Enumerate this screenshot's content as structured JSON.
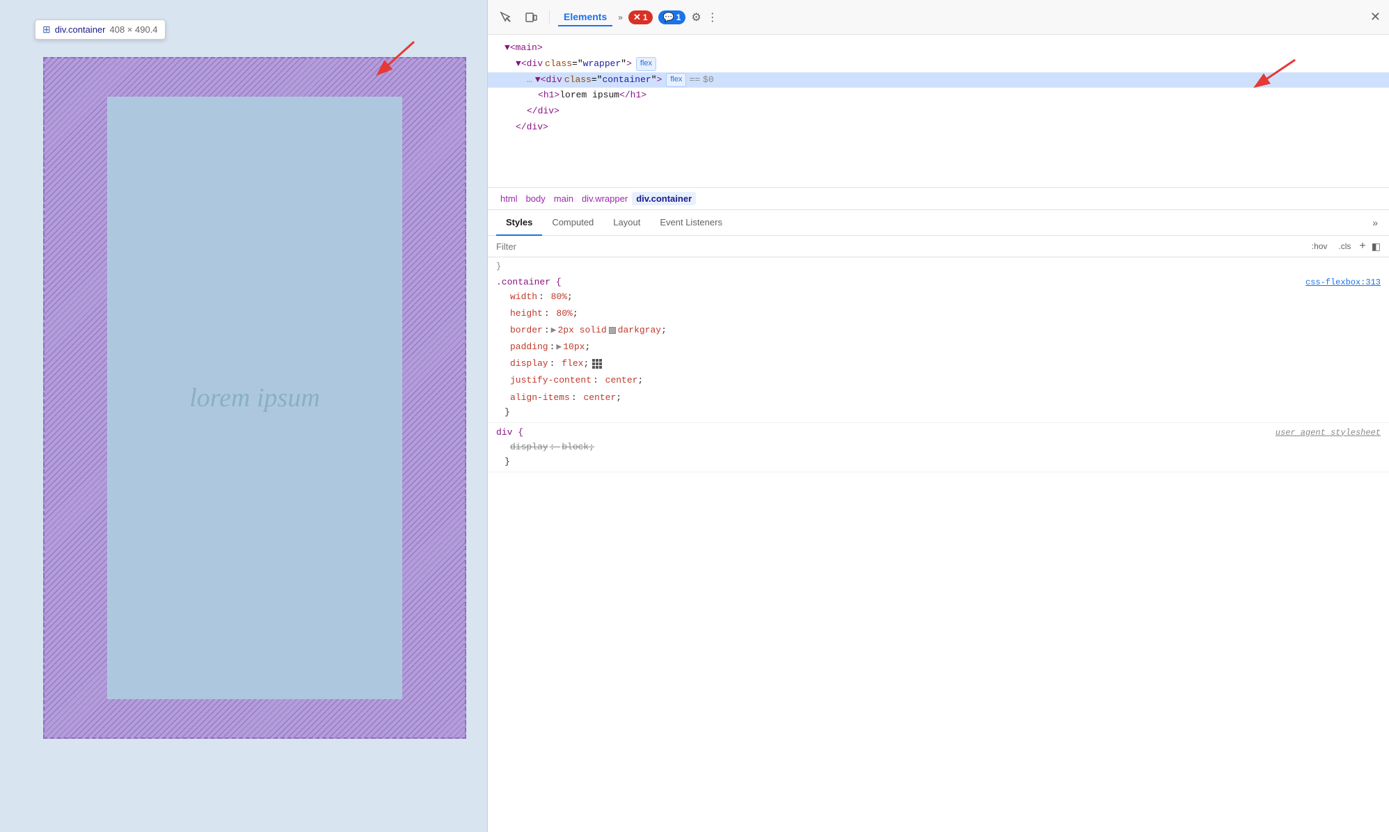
{
  "tooltip": {
    "icon": "⊞",
    "element_name": "div.container",
    "size": "408 × 490.4"
  },
  "preview": {
    "lorem_text": "lorem ipsum"
  },
  "devtools": {
    "toolbar": {
      "inspect_icon": "↖",
      "device_icon": "⧉",
      "tab_elements": "Elements",
      "chevron": "»",
      "error_count": "1",
      "comment_count": "1",
      "gear_icon": "⚙",
      "more_icon": "⋮",
      "close_icon": "✕"
    },
    "html_tree": [
      {
        "indent": 1,
        "content": "▼<main>",
        "type": "tag"
      },
      {
        "indent": 2,
        "content": "▼<div class=\"wrapper\">",
        "type": "tag",
        "badge": "flex"
      },
      {
        "indent": 3,
        "content": "▼<div class=\"container\">",
        "type": "tag",
        "badge": "flex",
        "selected": true,
        "extra": "== $0"
      },
      {
        "indent": 4,
        "content": "<h1>lorem ipsum</h1>",
        "type": "tag"
      },
      {
        "indent": 3,
        "content": "</div>",
        "type": "tag"
      },
      {
        "indent": 2,
        "content": "</div>",
        "type": "tag"
      }
    ],
    "breadcrumbs": [
      "html",
      "body",
      "main",
      "div.wrapper",
      "div.container"
    ],
    "panel_tabs": [
      "Styles",
      "Computed",
      "Layout",
      "Event Listeners",
      "»"
    ],
    "filter_placeholder": "Filter",
    "filter_buttons": [
      ":hov",
      ".cls",
      "+"
    ],
    "css_rules": [
      {
        "selector": ".container {",
        "source": "css-flexbox:313",
        "props": [
          {
            "name": "width",
            "value": "80%",
            "semicolon": true
          },
          {
            "name": "height",
            "value": "80%",
            "semicolon": true
          },
          {
            "name": "border",
            "value": "2px solid",
            "color_swatch": "darkgray",
            "color_name": "darkgray",
            "semicolon": true
          },
          {
            "name": "padding",
            "value": "10px",
            "has_arrow": true,
            "semicolon": true
          },
          {
            "name": "display",
            "value": "flex",
            "has_icon": true,
            "semicolon": true
          },
          {
            "name": "justify-content",
            "value": "center",
            "semicolon": true
          },
          {
            "name": "align-items",
            "value": "center",
            "semicolon": true
          }
        ]
      },
      {
        "selector": "div {",
        "source": "user agent stylesheet",
        "source_italic": true,
        "props": [
          {
            "name": "display",
            "value": "block",
            "semicolon": true,
            "strikethrough": true
          }
        ]
      }
    ]
  }
}
